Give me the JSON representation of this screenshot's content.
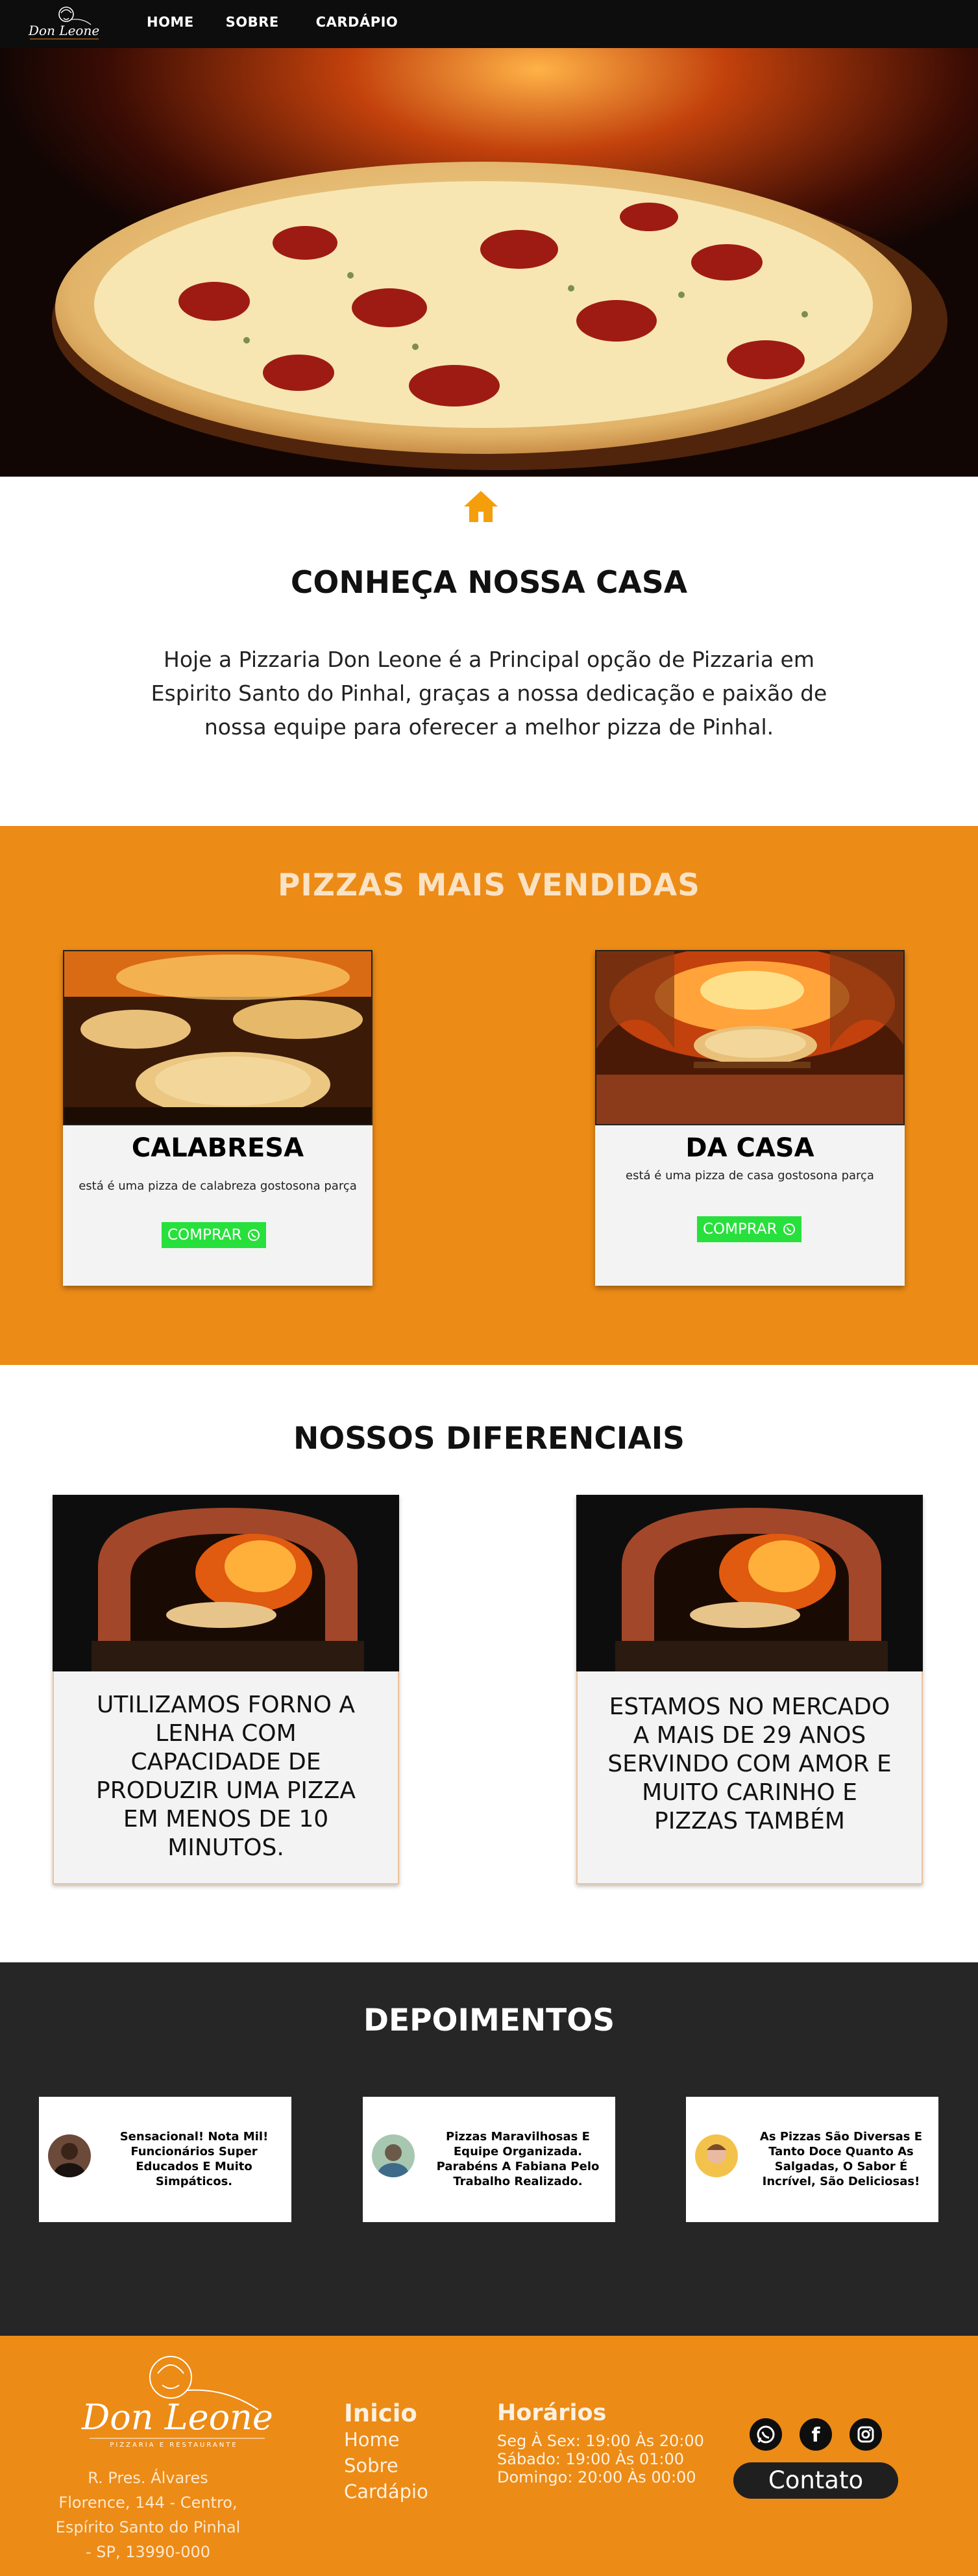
{
  "nav": {
    "logo_text": "Don Leone",
    "items": [
      "HOME",
      "SOBRE",
      "CARDÁPIO"
    ]
  },
  "about": {
    "title": "CONHEÇA NOSSA CASA",
    "text": "Hoje a Pizzaria Don Leone é a Principal opção de Pizzaria em Espirito Santo do Pinhal, graças a nossa dedicação e paixão de nossa equipe para oferecer a melhor pizza de Pinhal."
  },
  "pizzas": {
    "title": "PIZZAS MAIS VENDIDAS",
    "cards": [
      {
        "name": "CALABRESA",
        "desc": "está é uma pizza de calabreza gostosona parça",
        "button": "COMPRAR"
      },
      {
        "name": "DA CASA",
        "desc": "está é uma pizza de casa gostosona parça",
        "button": "COMPRAR"
      }
    ]
  },
  "diferenciais": {
    "title": "NOSSOS DIFERENCIAIS",
    "cards": [
      {
        "text": "UTILIZAMOS FORNO A LENHA COM CAPACIDADE DE PRODUZIR UMA PIZZA EM MENOS DE 10 MINUTOS."
      },
      {
        "text": "ESTAMOS NO MERCADO A MAIS DE 29 ANOS SERVINDO COM AMOR E MUITO CARINHO E PIZZAS TAMBÉM"
      }
    ]
  },
  "depoimentos": {
    "title": "DEPOIMENTOS",
    "items": [
      {
        "text": "Sensacional! Nota Mil! Funcionários Super Educados E Muito Simpáticos."
      },
      {
        "text": "Pizzas Maravilhosas E Equipe Organizada. Parabéns A Fabiana Pelo Trabalho Realizado."
      },
      {
        "text": "As Pizzas São Diversas E Tanto Doce Quanto As Salgadas, O Sabor É Incrível, São Deliciosas!"
      }
    ]
  },
  "footer": {
    "logo_text": "Don Leone",
    "logo_sub": "PIZZARIA E RESTAURANTE",
    "address": "R. Pres. Álvares Florence, 144 - Centro, Espírito Santo do Pinhal - SP, 13990-000",
    "nav_title": "Inicio",
    "nav_links": [
      "Home",
      "Sobre",
      "Cardápio"
    ],
    "hours_title": "Horários",
    "hours": [
      "Seg À Sex: 19:00 Às 20:00",
      "Sábado: 19:00 Às 01:00",
      "Domingo: 20:00 Às 00:00"
    ],
    "contact_button": "Contato",
    "social_icons": [
      "whatsapp-icon",
      "facebook-icon",
      "instagram-icon"
    ]
  },
  "colors": {
    "orange": "#ec8b16",
    "dark": "#262626",
    "buy_green": "#28e03c",
    "nav_bg": "#0d0d0d"
  }
}
